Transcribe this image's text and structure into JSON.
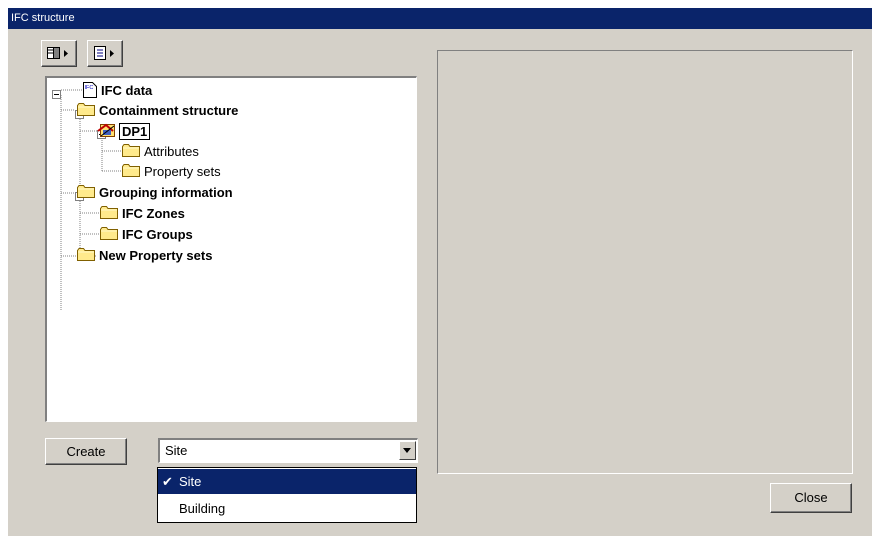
{
  "window": {
    "title": "IFC structure"
  },
  "toolbar": {
    "buttons": [
      {
        "icon": "panel-layout-icon"
      },
      {
        "icon": "document-list-icon"
      }
    ]
  },
  "tree": {
    "nodes": [
      {
        "label": "IFC data",
        "bold": true,
        "icon": "ifc-file-icon",
        "expanded": true
      },
      {
        "label": "Containment structure",
        "bold": true,
        "icon": "folder-icon",
        "expanded": true
      },
      {
        "label": "DP1",
        "bold": true,
        "icon": "project-object-icon",
        "expanded": true,
        "selected": true
      },
      {
        "label": "Attributes",
        "bold": false,
        "icon": "folder-icon"
      },
      {
        "label": "Property sets",
        "bold": false,
        "icon": "folder-icon"
      },
      {
        "label": "Grouping information",
        "bold": true,
        "icon": "folder-icon",
        "expanded": true
      },
      {
        "label": "IFC Zones",
        "bold": true,
        "icon": "folder-icon"
      },
      {
        "label": "IFC Groups",
        "bold": true,
        "icon": "folder-icon"
      },
      {
        "label": "New Property sets",
        "bold": true,
        "icon": "folder-icon"
      }
    ]
  },
  "create_button": {
    "label": "Create"
  },
  "type_select": {
    "value": "Site",
    "options": [
      {
        "label": "Site",
        "checked": true,
        "check_mark": "✔"
      },
      {
        "label": "Building",
        "checked": false
      }
    ]
  },
  "close_button": {
    "label": "Close"
  },
  "colors": {
    "title_bar": "#0a246a",
    "window_face": "#d4d0c8",
    "folder": "#ffea8c",
    "selection": "#0a246a"
  }
}
